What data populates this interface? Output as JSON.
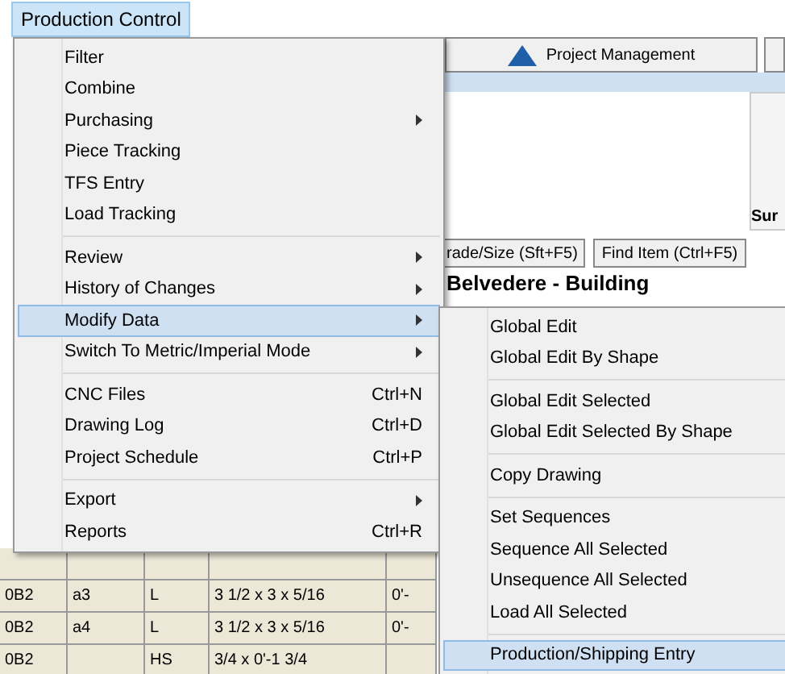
{
  "menubar": [
    {
      "label": "Production Control",
      "selected": true
    }
  ],
  "toolbar": {
    "tab": "Project Management",
    "side_label": "Sur",
    "buttons": [
      "rade/Size (Sft+F5)",
      "Find Item (Ctrl+F5)"
    ],
    "heading": "Belvedere - Building"
  },
  "table": {
    "rows": [
      [
        "0B2",
        "a3",
        "L",
        "3 1/2 x 3 x 5/16",
        "0'-"
      ],
      [
        "0B2",
        "a4",
        "L",
        "3 1/2 x 3 x 5/16",
        "0'-"
      ],
      [
        "0B2",
        "",
        "HS",
        "3/4 x 0'-1 3/4",
        ""
      ]
    ]
  },
  "menu": [
    {
      "kind": "item",
      "label": "Filter",
      "selected": false
    },
    {
      "kind": "item",
      "label": "Combine",
      "selected": false
    },
    {
      "kind": "item",
      "label": "Purchasing",
      "submenu": true,
      "selected": false
    },
    {
      "kind": "item",
      "label": "Piece Tracking",
      "selected": false
    },
    {
      "kind": "item",
      "label": "TFS Entry",
      "selected": false
    },
    {
      "kind": "item",
      "label": "Load Tracking",
      "selected": false
    },
    {
      "kind": "separator"
    },
    {
      "kind": "item",
      "label": "Review",
      "submenu": true,
      "selected": false
    },
    {
      "kind": "item",
      "label": "History of Changes",
      "submenu": true,
      "selected": false
    },
    {
      "kind": "item",
      "label": "Modify Data",
      "submenu": true,
      "selected": true
    },
    {
      "kind": "item",
      "label": "Switch To Metric/Imperial Mode",
      "submenu": true,
      "selected": false
    },
    {
      "kind": "separator"
    },
    {
      "kind": "item",
      "label": "CNC Files",
      "shortcut": "Ctrl+N",
      "selected": false
    },
    {
      "kind": "item",
      "label": "Drawing Log",
      "shortcut": "Ctrl+D",
      "selected": false
    },
    {
      "kind": "item",
      "label": "Project Schedule",
      "shortcut": "Ctrl+P",
      "selected": false
    },
    {
      "kind": "separator"
    },
    {
      "kind": "item",
      "label": "Export",
      "submenu": true,
      "selected": false
    },
    {
      "kind": "item",
      "label": "Reports",
      "shortcut": "Ctrl+R",
      "selected": false
    }
  ],
  "submenu": [
    {
      "kind": "item",
      "label": "Global Edit",
      "selected": false
    },
    {
      "kind": "item",
      "label": "Global Edit By Shape",
      "selected": false
    },
    {
      "kind": "separator"
    },
    {
      "kind": "item",
      "label": "Global Edit Selected",
      "selected": false
    },
    {
      "kind": "item",
      "label": "Global Edit Selected By Shape",
      "selected": false
    },
    {
      "kind": "separator"
    },
    {
      "kind": "item",
      "label": "Copy Drawing",
      "selected": false
    },
    {
      "kind": "separator"
    },
    {
      "kind": "item",
      "label": "Set Sequences",
      "selected": false
    },
    {
      "kind": "item",
      "label": "Sequence All Selected",
      "selected": false
    },
    {
      "kind": "item",
      "label": "Unsequence All Selected",
      "selected": false
    },
    {
      "kind": "item",
      "label": "Load All Selected",
      "selected": false
    },
    {
      "kind": "separator"
    },
    {
      "kind": "item",
      "label": "Production/Shipping Entry",
      "selected": true
    }
  ]
}
